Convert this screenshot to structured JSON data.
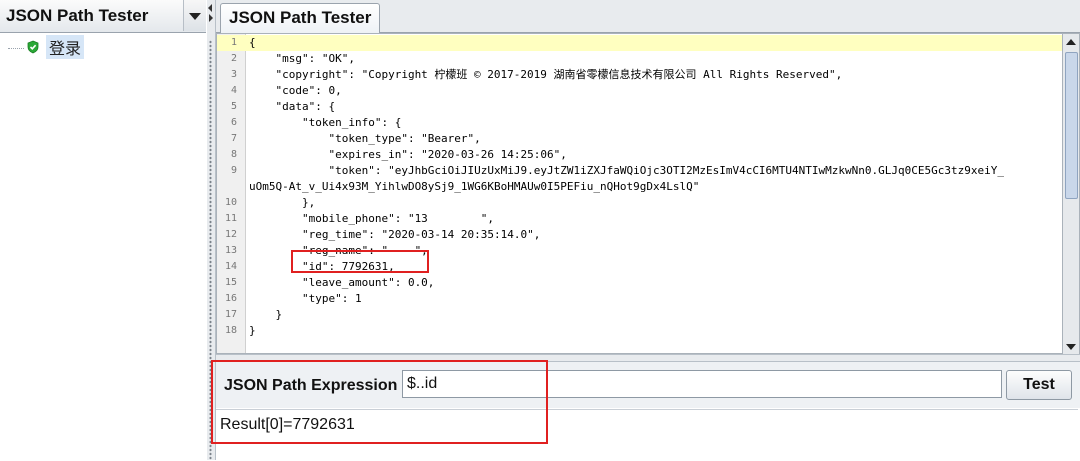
{
  "left_panel": {
    "selector_value": "JSON Path Tester",
    "tree": [
      {
        "label": "登录",
        "icon": "check-shield-icon"
      }
    ]
  },
  "tab": {
    "label": "JSON Path Tester"
  },
  "editor": {
    "lines": [
      {
        "n": "1",
        "text": "{"
      },
      {
        "n": "2",
        "text": "    \"msg\": \"OK\","
      },
      {
        "n": "3",
        "text": "    \"copyright\": \"Copyright 柠檬班 © 2017-2019 湖南省零檬信息技术有限公司 All Rights Reserved\","
      },
      {
        "n": "4",
        "text": "    \"code\": 0,"
      },
      {
        "n": "5",
        "text": "    \"data\": {"
      },
      {
        "n": "6",
        "text": "        \"token_info\": {"
      },
      {
        "n": "7",
        "text": "            \"token_type\": \"Bearer\","
      },
      {
        "n": "8",
        "text": "            \"expires_in\": \"2020-03-26 14:25:06\","
      },
      {
        "n": "9",
        "text": "            \"token\": \"eyJhbGciOiJIUzUxMiJ9.eyJtZW1iZXJfaWQiOjc3OTI2MzEsImV4cCI6MTU4NTIwMzkwNn0.GLJq0CE5Gc3tz9xeiY_"
      },
      {
        "n": "",
        "text": "uOm5Q-At_v_Ui4x93M_YihlwDO8ySj9_1WG6KBoHMAUw0I5PEFiu_nQHot9gDx4LslQ\""
      },
      {
        "n": "10",
        "text": "        },"
      },
      {
        "n": "11",
        "text": "        \"mobile_phone\": \"13        \","
      },
      {
        "n": "12",
        "text": "        \"reg_time\": \"2020-03-14 20:35:14.0\","
      },
      {
        "n": "13",
        "text": "        \"reg_name\": \"    \","
      },
      {
        "n": "14",
        "text": "        \"id\": 7792631,"
      },
      {
        "n": "15",
        "text": "        \"leave_amount\": 0.0,"
      },
      {
        "n": "16",
        "text": "        \"type\": 1"
      },
      {
        "n": "17",
        "text": "    }"
      },
      {
        "n": "18",
        "text": "}"
      }
    ]
  },
  "expression": {
    "label": "JSON Path Expression",
    "value": "$..id",
    "test_label": "Test"
  },
  "result": {
    "text": "Result[0]=7792631"
  },
  "colors": {
    "annotation": "#e02020",
    "current_line": "#ffffc0",
    "selection": "#d6e6f7"
  }
}
